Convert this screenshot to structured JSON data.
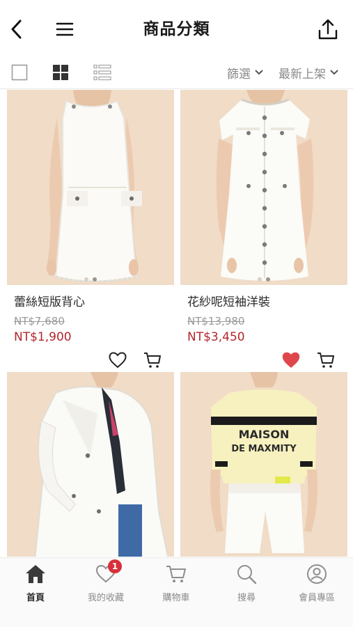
{
  "header": {
    "title": "商品分類"
  },
  "toolbar": {
    "filter_label": "篩選",
    "sort_label": "最新上架"
  },
  "products": [
    {
      "name": "蕾絲短版背心",
      "original_price": "NT$7,680",
      "price": "NT$1,900",
      "favorited": false,
      "image": "white-lace-sleeveless-dress"
    },
    {
      "name": "花紗呢短袖洋裝",
      "original_price": "NT$13,980",
      "price": "NT$3,450",
      "favorited": true,
      "image": "white-tweed-short-sleeve-dress"
    },
    {
      "name": "",
      "original_price": "",
      "price": "",
      "favorited": false,
      "image": "white-blazer-with-scarf"
    },
    {
      "name": "",
      "original_price": "",
      "price": "",
      "favorited": false,
      "image": "yellow-maison-sweater-white-shorts"
    }
  ],
  "card_graphic": {
    "sweater_text": "MAISON\nDE MAXMITY"
  },
  "bottom_nav": {
    "items": [
      {
        "label": "首頁",
        "icon": "home-icon",
        "active": true
      },
      {
        "label": "我的收藏",
        "icon": "heart-icon",
        "badge": "1"
      },
      {
        "label": "購物車",
        "icon": "cart-icon"
      },
      {
        "label": "搜尋",
        "icon": "search-icon"
      },
      {
        "label": "會員專區",
        "icon": "user-icon"
      }
    ]
  },
  "colors": {
    "price": "#b3262b",
    "favorite": "#e0474c",
    "badge": "#d7303a",
    "background": "#f0dcc7"
  }
}
